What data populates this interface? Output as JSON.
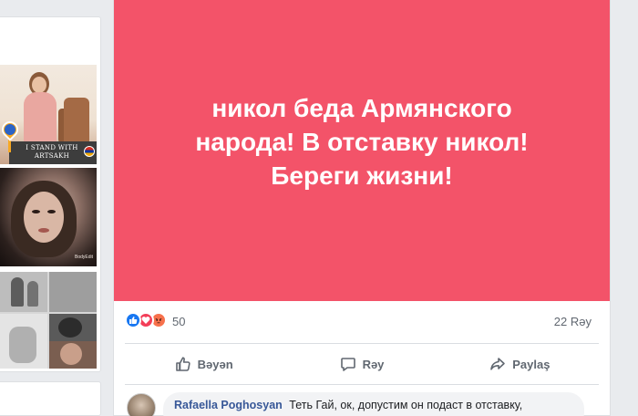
{
  "feed": {
    "left_photos": [
      {
        "name": "artsakh-profile-photo",
        "caption": "I STAND WITH ARTSAKH"
      },
      {
        "name": "woman-portrait-photo",
        "caption": "BodyEdit"
      },
      {
        "name": "collage-photo",
        "caption": ""
      }
    ]
  },
  "post": {
    "text": "никол беда Армянского народа! В отставку никол! Береги жизни!",
    "background_color": "#f35369",
    "reactions": {
      "icons": [
        "like-icon",
        "love-icon",
        "angry-icon"
      ],
      "count": "50"
    },
    "comments_count": "22 Rəy",
    "actions": {
      "like": "Bəyən",
      "comment": "Rəy",
      "share": "Paylaş"
    }
  },
  "comment": {
    "author": "Rafaella Poghosyan",
    "text": "Теть Гай, ок, допустим он подаст в отставку,"
  }
}
